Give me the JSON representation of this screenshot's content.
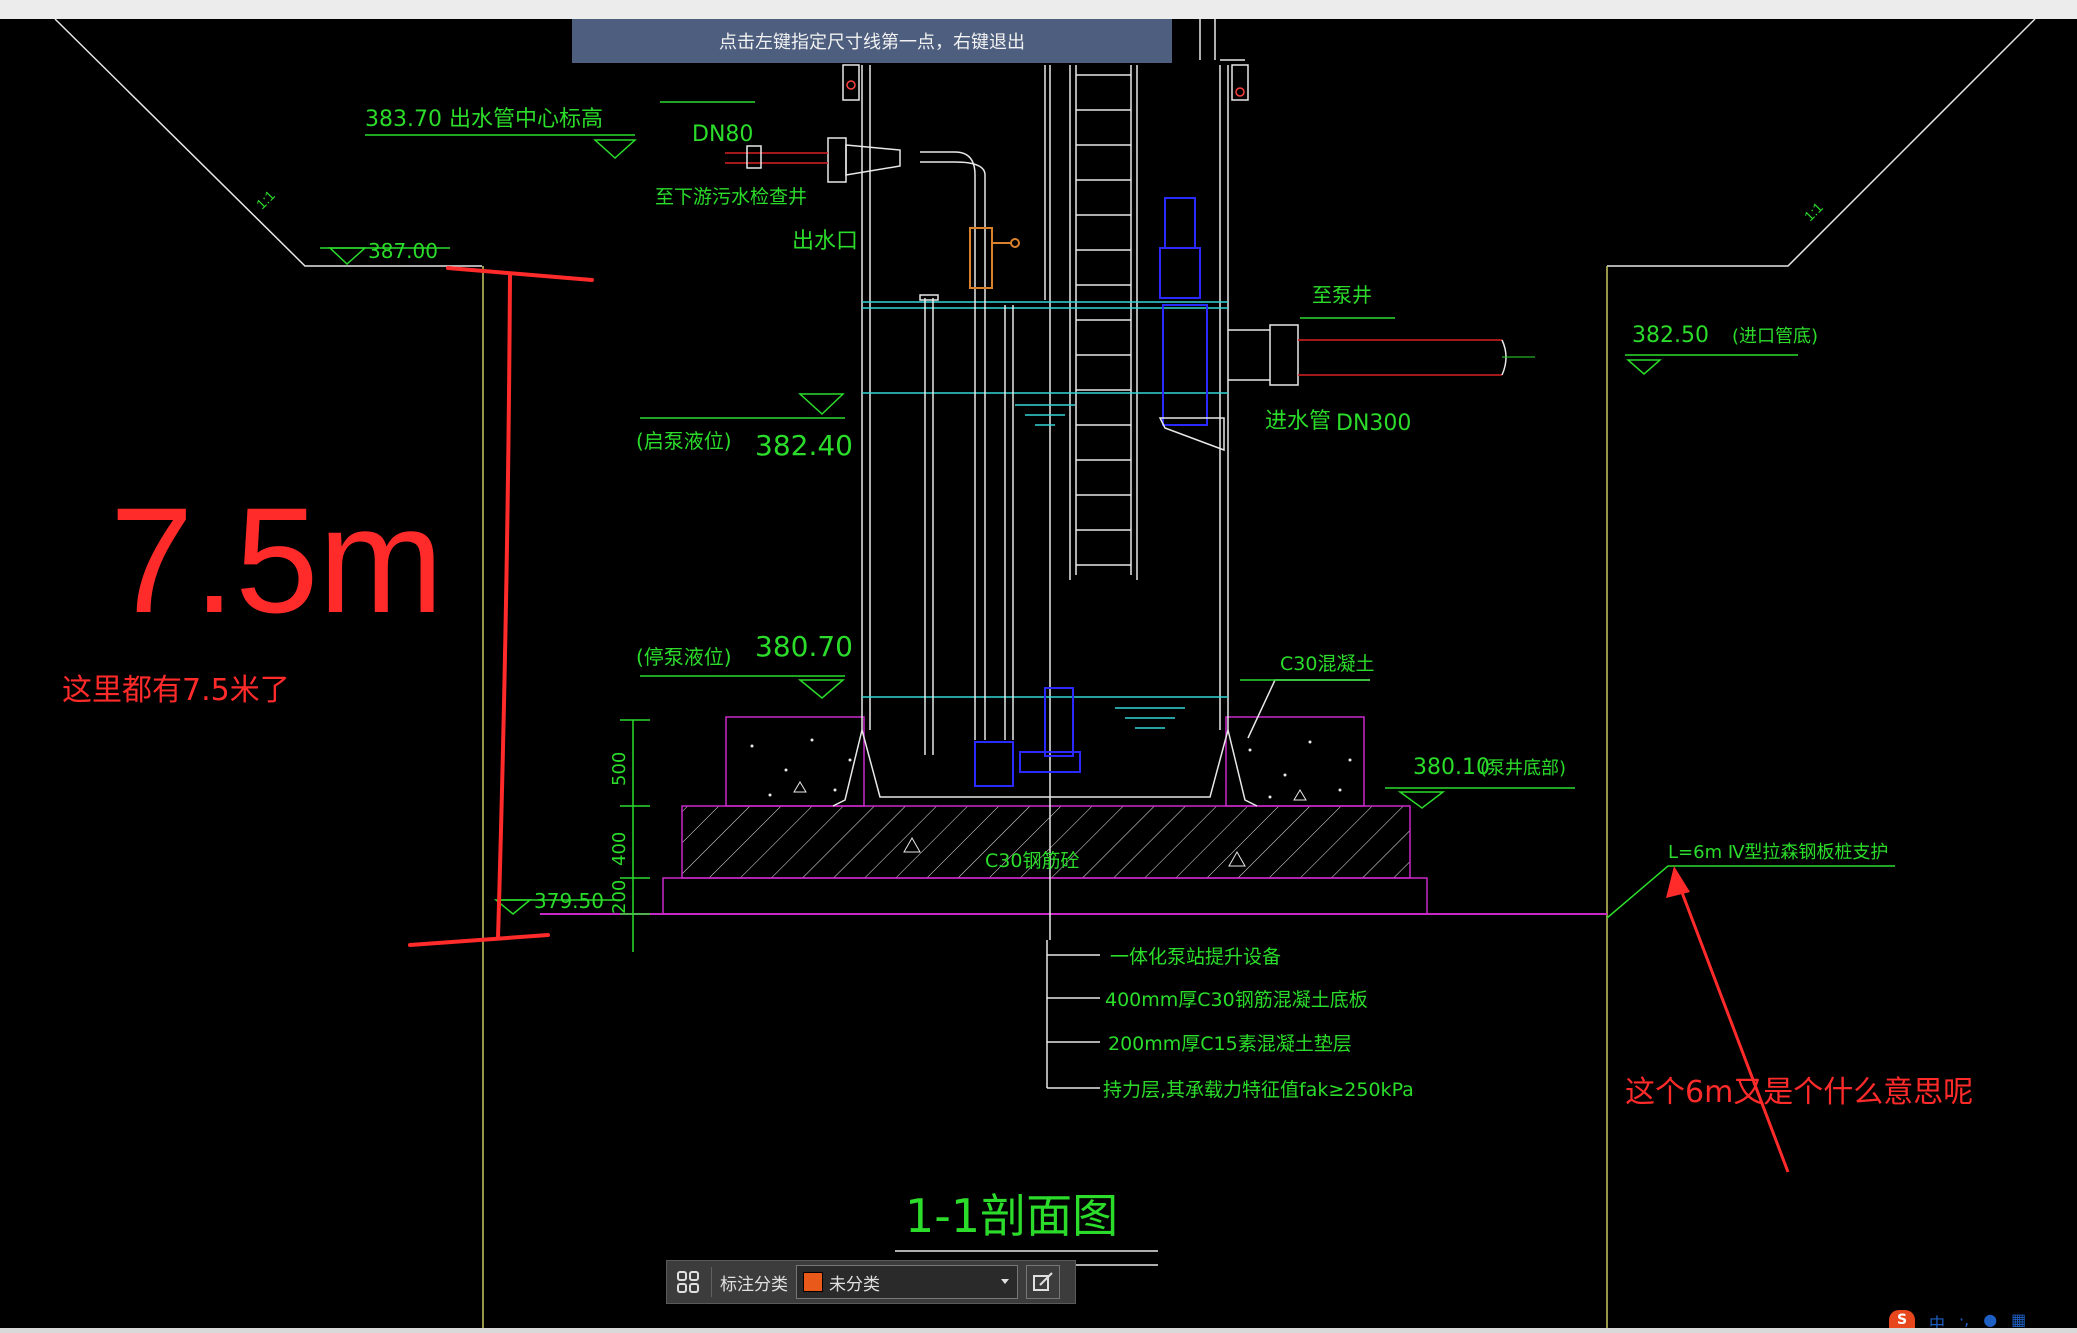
{
  "prompt": "点击左键指定尺寸线第一点，右键退出",
  "drawing": {
    "labels": {
      "outlet_center_elev": "383.70 出水管中心标高",
      "dn80": "DN80",
      "to_downstream": "至下游污水检查井",
      "outlet": "出水口",
      "ground_left": "387.00",
      "to_pump_well": "至泵井",
      "inlet_elev": "382.50",
      "inlet_elev_note": "(进口管底)",
      "inlet_pipe": "进水管",
      "dn300": "DN300",
      "start_level_tag": "(启泵液位)",
      "start_level": "382.40",
      "stop_level_tag": "(停泵液位)",
      "stop_level": "380.70",
      "c30_concrete": "C30混凝土",
      "bottom_elev": "380.10",
      "bottom_elev_note": "(泵井底部)",
      "dim_500": "500",
      "dim_400": "400",
      "dim_200": "200",
      "pit_elev": "379.50",
      "c30_slab": "C30钢筋砼",
      "support_note": "L=6m Ⅳ型拉森钢板桩支护",
      "leader1": "一体化泵站提升设备",
      "leader2": "400mm厚C30钢筋混凝土底板",
      "leader3": "200mm厚C15素混凝土垫层",
      "leader4": "持力层,其承载力特征值fak≥250kPa",
      "section_title": "1-1剖面图",
      "slope": "1:1"
    },
    "annotations": {
      "big_text": "7.5m",
      "note_left": "这里都有7.5米了",
      "note_right": "这个6m又是个什么意思呢"
    }
  },
  "toolbar": {
    "grid_icon": "grid-icon",
    "category_label": "标注分类",
    "category_value": "未分类",
    "edit_icon": "edit-icon"
  },
  "ime": {
    "logo": "S",
    "mode": "中"
  },
  "colors": {
    "cad_green": "#2bdc2b",
    "cad_white": "#e8e8e8",
    "cad_cyan": "#33d6d6",
    "cad_magenta": "#c828c8",
    "cad_blue": "#2a2aff",
    "cad_orange": "#d9822b",
    "cad_yellow": "#c8c864",
    "annotation_red": "#ff2a2a",
    "prompt_bg": "#4d5e7f"
  }
}
